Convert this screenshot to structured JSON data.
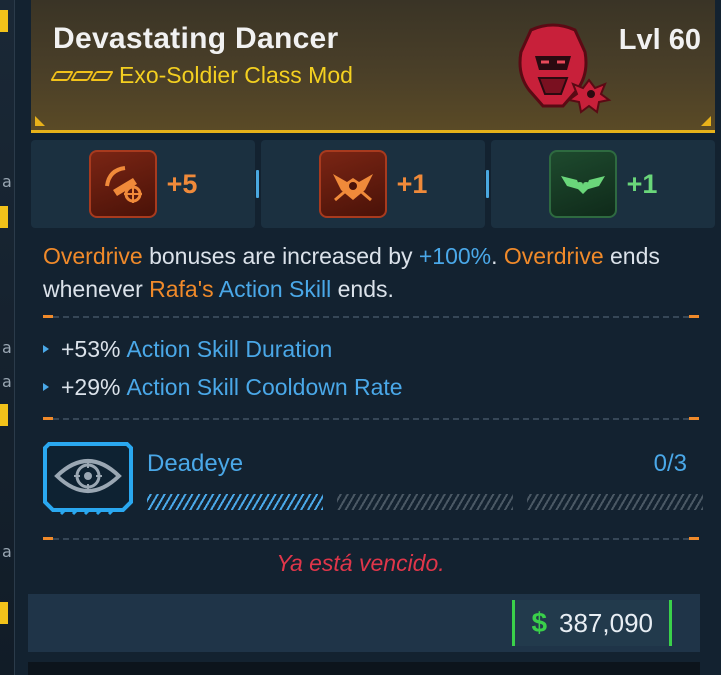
{
  "item": {
    "name": "Devastating Dancer",
    "type": "Exo-Soldier Class Mod",
    "level": "Lvl 60",
    "rarity_color": "#f2c21a"
  },
  "skills": [
    {
      "icon": "skill-crosshair-icon",
      "bonus": "+5",
      "color": "#f08a3a"
    },
    {
      "icon": "skill-winged-emblem-icon",
      "bonus": "+1",
      "color": "#f08a3a"
    },
    {
      "icon": "skill-heart-wings-icon",
      "bonus": "+1",
      "color": "#6ad67a"
    }
  ],
  "description": {
    "p1": "Overdrive",
    "p2": " bonuses are increased by ",
    "p3": "+100%",
    "p4": ". ",
    "p5": "Overdrive",
    "p6": " ends whenever ",
    "p7": "Rafa's",
    "p8": " ",
    "p9": "Action Skill",
    "p10": " ends."
  },
  "stats": [
    {
      "value": "+53%",
      "name": "Action Skill Duration"
    },
    {
      "value": "+29%",
      "name": "Action Skill Cooldown Rate"
    }
  ],
  "firmware": {
    "name": "Deadeye",
    "count": "0/3",
    "icon": "eye-target-icon",
    "segments_filled": 1,
    "segments_total": 3
  },
  "status_text": "Ya está vencido.",
  "price": {
    "symbol": "$",
    "value": "387,090",
    "accent": "#3ad04a"
  },
  "left_strip": {
    "labels": [
      "a",
      "a",
      "a",
      "a"
    ]
  }
}
